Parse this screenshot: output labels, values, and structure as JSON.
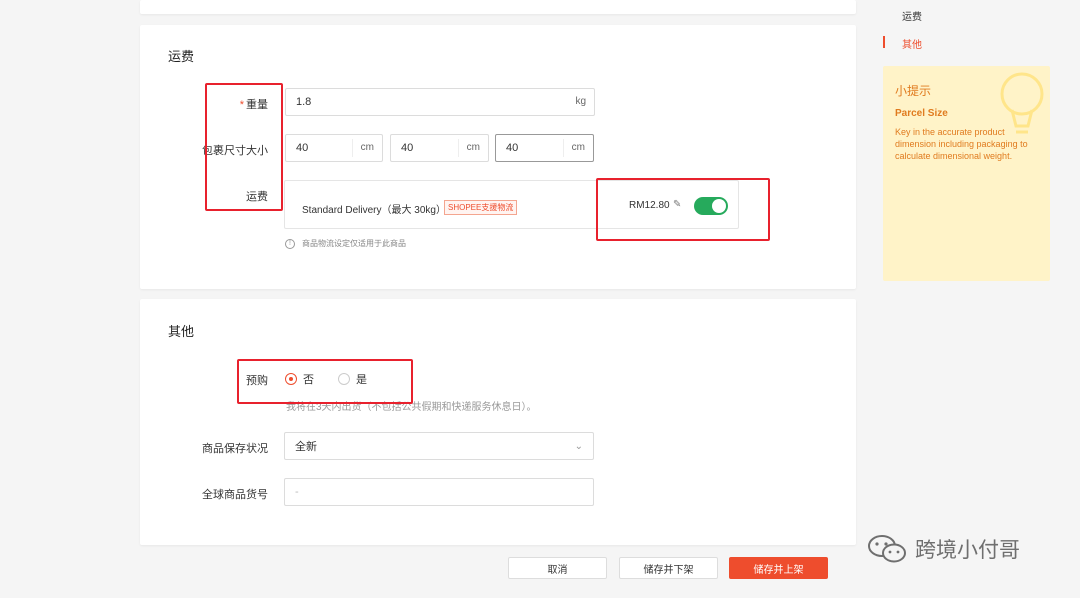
{
  "shipping": {
    "title": "运费",
    "weight_required": "*",
    "weight_label": "重量",
    "weight_value": "1.8",
    "weight_unit": "kg",
    "size_label": "包裹尺寸大小",
    "dims": [
      {
        "value": "40",
        "unit": "cm"
      },
      {
        "value": "40",
        "unit": "cm"
      },
      {
        "value": "40",
        "unit": "cm"
      }
    ],
    "fee_label": "运费",
    "channel_name": "Standard Delivery（最大 30kg）",
    "channel_tag": "SHOPEE支援物流",
    "channel_price": "RM12.80",
    "channel_enabled": true,
    "hint": "商品物流设定仅适用于此商品"
  },
  "other": {
    "title": "其他",
    "preorder_label": "预购",
    "preorder_options": [
      "否",
      "是"
    ],
    "preorder_selected": "否",
    "preorder_hint": "我将在3天内出货（不包括公共假期和快递服务休息日）。",
    "condition_label": "商品保存状况",
    "condition_value": "全新",
    "sku_label": "全球商品货号",
    "sku_placeholder": "-"
  },
  "buttons": {
    "cancel": "取消",
    "save_unlist": "储存并下架",
    "save_publish": "储存并上架"
  },
  "side_nav": {
    "items": [
      "运费",
      "其他"
    ],
    "active": "其他"
  },
  "tips": {
    "title": "小提示",
    "subtitle": "Parcel Size",
    "body": "Key in the accurate product dimension including packaging to calculate dimensional weight."
  },
  "watermark": "跨境小付哥",
  "colors": {
    "brand": "#ee4d2d",
    "toggle_on": "#26aa5c",
    "annotation": "#e8212d",
    "tips_bg": "#fff3c8"
  }
}
